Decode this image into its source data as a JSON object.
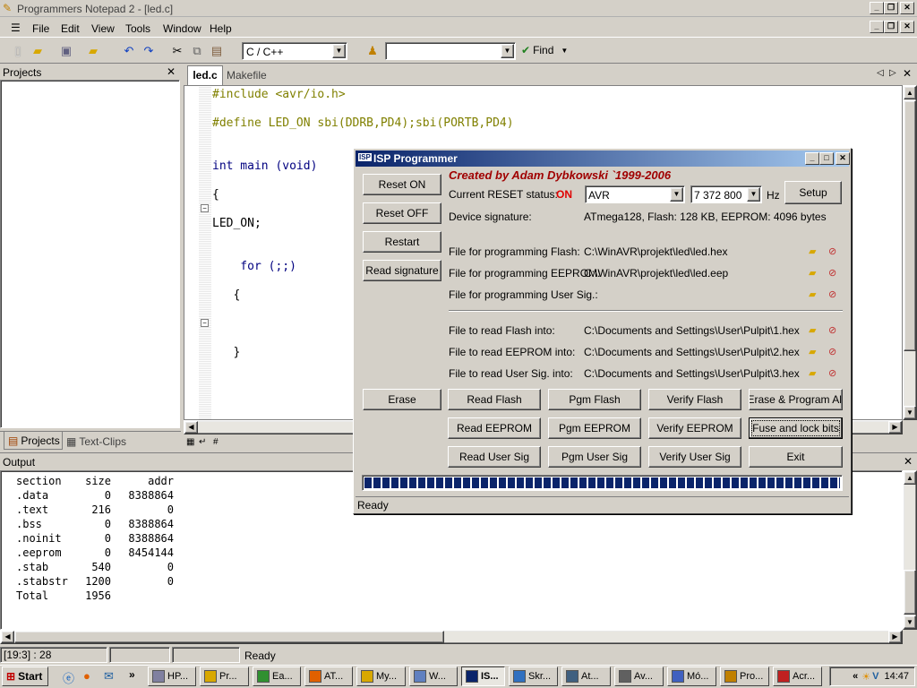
{
  "app": {
    "title": "Programmers Notepad 2 - [led.c]",
    "menu": [
      "File",
      "Edit",
      "View",
      "Tools",
      "Window",
      "Help"
    ],
    "language": "C / C++",
    "find_label": "Find",
    "search_value": ""
  },
  "projects": {
    "title": "Projects",
    "tab_projects": "Projects",
    "tab_clips": "Text-Clips"
  },
  "editor": {
    "tabs": [
      "led.c",
      "Makefile"
    ],
    "lines": [
      {
        "text": "#include <avr/io.h>",
        "color": "#808000"
      },
      {
        "text": "",
        "color": "#000"
      },
      {
        "text": "#define LED_ON sbi(DDRB,PD4);sbi(PORTB,PD4)",
        "color": "#808000"
      },
      {
        "text": "",
        "color": "#000"
      },
      {
        "text": "",
        "color": "#000"
      },
      {
        "text": "int main (void)",
        "color": "#000080"
      },
      {
        "text": "",
        "color": "#000"
      },
      {
        "text": "{",
        "color": "#000"
      },
      {
        "text": "",
        "color": "#000"
      },
      {
        "text": "LED_ON;",
        "color": "#000"
      },
      {
        "text": "",
        "color": "#000"
      },
      {
        "text": "",
        "color": "#000"
      },
      {
        "text": "    for (;;)",
        "color": "#000080"
      },
      {
        "text": "",
        "color": "#000"
      },
      {
        "text": "   {",
        "color": "#000"
      },
      {
        "text": "",
        "color": "#000"
      },
      {
        "text": "",
        "color": "#000"
      },
      {
        "text": "",
        "color": "#000"
      },
      {
        "text": "   }",
        "color": "#000"
      }
    ]
  },
  "output": {
    "title": "Output",
    "header": {
      "section": "section",
      "size": "size",
      "addr": "addr"
    },
    "rows": [
      {
        "section": ".data",
        "size": "0",
        "addr": "8388864"
      },
      {
        "section": ".text",
        "size": "216",
        "addr": "0"
      },
      {
        "section": ".bss",
        "size": "0",
        "addr": "8388864"
      },
      {
        "section": ".noinit",
        "size": "0",
        "addr": "8388864"
      },
      {
        "section": ".eeprom",
        "size": "0",
        "addr": "8454144"
      },
      {
        "section": ".stab",
        "size": "540",
        "addr": "0"
      },
      {
        "section": ".stabstr",
        "size": "1200",
        "addr": "0"
      },
      {
        "section": "Total",
        "size": "1956",
        "addr": ""
      }
    ]
  },
  "statusbar": {
    "position": "[19:3] : 28",
    "state": "Ready"
  },
  "isp": {
    "title": "ISP Programmer",
    "credit": "Created by Adam Dybkowski `1999-2006",
    "reset_status_label": "Current RESET status:",
    "reset_status_value": "ON",
    "device": "AVR",
    "frequency": "7 372 800",
    "hz": "Hz",
    "setup": "Setup",
    "signature_label": "Device signature:",
    "signature_value": "ATmega128, Flash: 128 KB, EEPROM: 4096 bytes",
    "left_buttons": [
      "Reset ON",
      "Reset OFF",
      "Restart",
      "Read signature"
    ],
    "erase": "Erase",
    "files": [
      {
        "label": "File for programming Flash:",
        "value": "C:\\WinAVR\\projekt\\led\\led.hex"
      },
      {
        "label": "File for programming EEPROM:",
        "value": "C:\\WinAVR\\projekt\\led\\led.eep"
      },
      {
        "label": "File for programming User Sig.:",
        "value": ""
      },
      {
        "label": "File to read Flash into:",
        "value": "C:\\Documents and Settings\\User\\Pulpit\\1.hex"
      },
      {
        "label": "File to read EEPROM into:",
        "value": "C:\\Documents and Settings\\User\\Pulpit\\2.hex"
      },
      {
        "label": "File to read User Sig. into:",
        "value": "C:\\Documents and Settings\\User\\Pulpit\\3.hex"
      }
    ],
    "grid_buttons": [
      [
        "Read Flash",
        "Pgm Flash",
        "Verify Flash",
        "Erase & Program All"
      ],
      [
        "Read EEPROM",
        "Pgm EEPROM",
        "Verify EEPROM",
        "Fuse and lock bits"
      ],
      [
        "Read User Sig",
        "Pgm User Sig",
        "Verify User Sig",
        "Exit"
      ]
    ],
    "progress": 1.0,
    "status": "Ready"
  },
  "taskbar": {
    "start": "Start",
    "items": [
      "HP...",
      "Pr...",
      "Ea...",
      "AT...",
      "My...",
      "W...",
      "IS...",
      "Skr...",
      "At...",
      "Av...",
      "Mó...",
      "Pro...",
      "Acr..."
    ],
    "clock": "14:47"
  }
}
